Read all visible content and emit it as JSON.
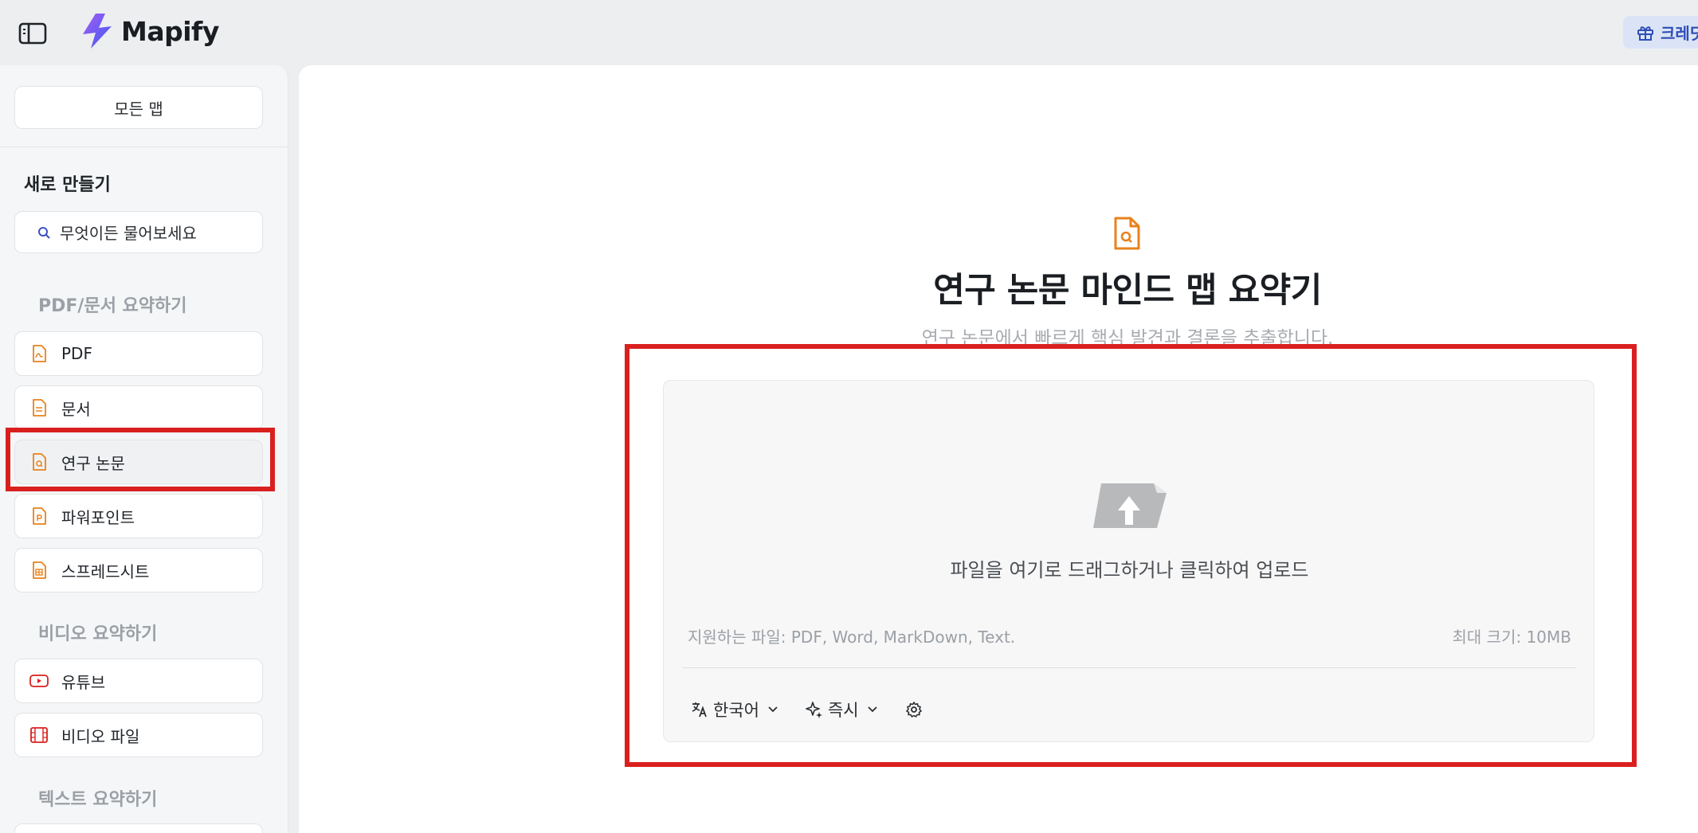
{
  "app": {
    "name": "Mapify",
    "credits_label": "크레딧"
  },
  "sidebar": {
    "all_maps": "모든 맵",
    "new_title": "새로 만들기",
    "ask_placeholder": "무엇이든 물어보세요",
    "sections": [
      {
        "title": "PDF/문서 요약하기",
        "items": [
          {
            "label": "PDF",
            "icon": "pdf-file-icon"
          },
          {
            "label": "문서",
            "icon": "document-icon"
          },
          {
            "label": "연구 논문",
            "icon": "research-paper-icon",
            "active": true
          },
          {
            "label": "파워포인트",
            "icon": "powerpoint-icon"
          },
          {
            "label": "스프레드시트",
            "icon": "spreadsheet-icon"
          }
        ]
      },
      {
        "title": "비디오 요약하기",
        "items": [
          {
            "label": "유튜브",
            "icon": "youtube-icon"
          },
          {
            "label": "비디오 파일",
            "icon": "film-icon"
          }
        ]
      },
      {
        "title": "텍스트 요약하기",
        "items": []
      }
    ]
  },
  "main": {
    "title": "연구 논문 마인드 맵 요약기",
    "subtitle": "연구 논문에서 빠르게 핵심 발견과 결론을 추출합니다.",
    "upload": {
      "prompt": "파일을 여기로 드래그하거나 클릭하여 업로드",
      "supported": "지원하는 파일: PDF, Word, MarkDown, Text.",
      "max_size": "최대 크기: 10MB"
    },
    "toolbar": {
      "language": "한국어",
      "mode": "즉시"
    }
  },
  "colors": {
    "accent_orange": "#e8821c",
    "highlight_red": "#d9201f",
    "credits_blue": "#2e4db5",
    "logo_purple": "#7b3ff2"
  }
}
